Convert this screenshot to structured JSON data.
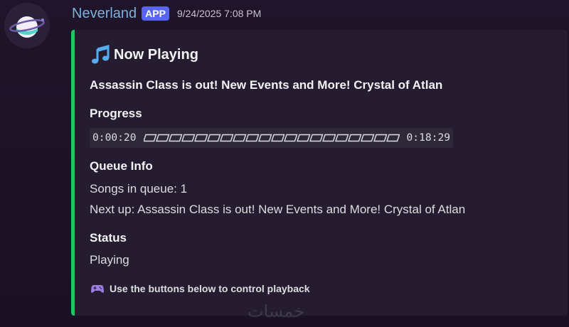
{
  "message": {
    "username": "Neverland",
    "badge": "APP",
    "timestamp": "9/24/2025 7:08 PM"
  },
  "embed": {
    "accent_color": "#23c55e",
    "title": "Now Playing",
    "title_icon": "musical-note-icon",
    "track_title": "Assassin Class is out! New Events and More! Crystal of Atlan",
    "progress": {
      "label": "Progress",
      "elapsed": "0:00:20",
      "total": "0:18:29",
      "fraction": 0.018,
      "segments": 20
    },
    "queue": {
      "label": "Queue Info",
      "songs_in_queue": "Songs in queue: 1",
      "next_up": "Next up: Assassin Class is out! New Events and More! Crystal of Atlan"
    },
    "status": {
      "label": "Status",
      "value": "Playing"
    },
    "footer": {
      "icon": "gamepad-icon",
      "text": "Use the buttons below to control playback"
    }
  },
  "watermark": "خمسات",
  "colors": {
    "username": "#7bb0dc",
    "badge": "#5865f2",
    "background": "#1f1429",
    "embed_background": "#251c30"
  }
}
